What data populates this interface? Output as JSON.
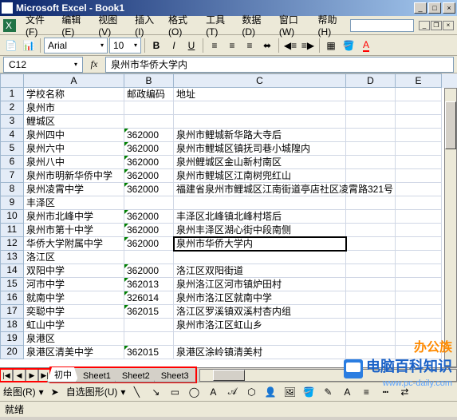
{
  "titlebar": {
    "text": "Microsoft Excel - Book1"
  },
  "menu": {
    "file": "文件(F)",
    "edit": "编辑(E)",
    "view": "视图(V)",
    "insert": "插入(I)",
    "format": "格式(O)",
    "tools": "工具(T)",
    "data": "数据(D)",
    "window": "窗口(W)",
    "help": "帮助(H)"
  },
  "toolbar": {
    "font": "Arial",
    "size": "10"
  },
  "namebox": "C12",
  "formula": "泉州市华侨大学内",
  "columns": [
    "A",
    "B",
    "C",
    "D",
    "E"
  ],
  "headers": {
    "A": "学校名称",
    "B": "邮政编码",
    "C": "地址"
  },
  "rows": [
    {
      "n": 1,
      "A": "学校名称",
      "B": "邮政编码",
      "C": "地址"
    },
    {
      "n": 2,
      "A": "泉州市"
    },
    {
      "n": 3,
      "A": "鲤城区"
    },
    {
      "n": 4,
      "A": "泉州四中",
      "B": "362000",
      "C": "泉州市鲤城新华路大寺后",
      "err": true
    },
    {
      "n": 5,
      "A": "泉州六中",
      "B": "362000",
      "C": "泉州市鲤城区镇抚司巷小城隍内",
      "err": true
    },
    {
      "n": 6,
      "A": "泉州八中",
      "B": "362000",
      "C": "泉州鲤城区金山新村南区",
      "err": true
    },
    {
      "n": 7,
      "A": "泉州市明新华侨中学",
      "B": "362000",
      "C": "泉州市鲤城区江南树兜红山",
      "err": true
    },
    {
      "n": 8,
      "A": "泉州凌霄中学",
      "B": "362000",
      "C": "福建省泉州市鲤城区江南街道亭店社区凌霄路321号",
      "err": true
    },
    {
      "n": 9,
      "A": "丰泽区"
    },
    {
      "n": 10,
      "A": "泉州市北峰中学",
      "B": "362000",
      "C": "丰泽区北峰镇北峰村塔后",
      "err": true
    },
    {
      "n": 11,
      "A": "泉州市第十中学",
      "B": "362000",
      "C": "泉州丰泽区湖心街中段南侧",
      "err": true
    },
    {
      "n": 12,
      "A": "华侨大学附属中学",
      "B": "362000",
      "C": "泉州市华侨大学内",
      "err": true,
      "active": true
    },
    {
      "n": 13,
      "A": "洛江区"
    },
    {
      "n": 14,
      "A": "双阳中学",
      "B": "362000",
      "C": "洛江区双阳街道",
      "err": true
    },
    {
      "n": 15,
      "A": "河市中学",
      "B": "362013",
      "C": "泉州洛江区河市镇炉田村",
      "err": true
    },
    {
      "n": 16,
      "A": "就南中学",
      "B": "326014",
      "C": "泉州市洛江区就南中学",
      "err": true
    },
    {
      "n": 17,
      "A": "奕聪中学",
      "B": "362015",
      "C": "洛江区罗溪镇双溪村杏内组",
      "err": true
    },
    {
      "n": 18,
      "A": "虹山中学",
      "B": "",
      "C": "泉州市洛江区虹山乡"
    },
    {
      "n": 19,
      "A": "泉港区"
    },
    {
      "n": 20,
      "A": "泉港区清美中学",
      "B": "362015",
      "C": "泉港区涂岭镇清美村",
      "err": true
    }
  ],
  "tabs": {
    "nav": [
      "|◀",
      "◀",
      "▶",
      "▶|"
    ],
    "sheets": [
      "初中",
      "Sheet1",
      "Sheet2",
      "Sheet3"
    ],
    "active": 0
  },
  "drawbar": {
    "label": "绘图(R)",
    "autoshape": "自选图形(U)"
  },
  "status": "就绪",
  "watermark": {
    "line1": "办公族",
    "line2": "电脑百科知识",
    "line3": "www.pc-daily.com"
  }
}
